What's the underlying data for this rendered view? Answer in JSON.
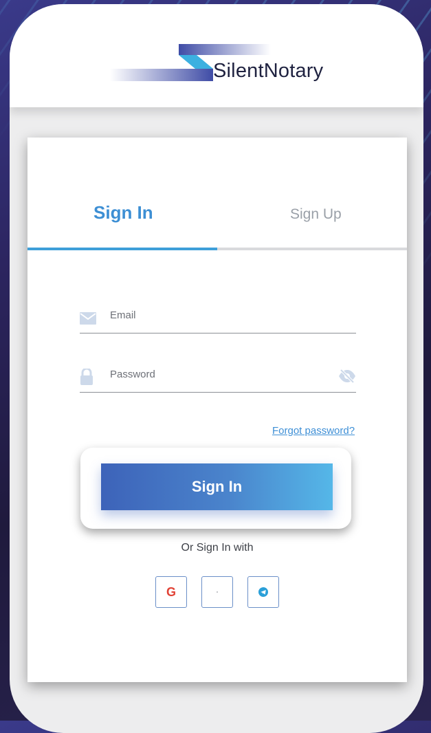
{
  "header": {
    "brand_name": "SilentNotary"
  },
  "tabs": {
    "sign_in": "Sign In",
    "sign_up": "Sign Up",
    "active": "Sign In"
  },
  "form": {
    "email_label": "Email",
    "password_label": "Password",
    "forgot_link": "Forgot password?",
    "submit_label": "Sign In"
  },
  "social": {
    "caption": "Or Sign In with",
    "google_letter": "G",
    "providers": [
      "google-icon",
      "blank-icon",
      "telegram-icon"
    ]
  },
  "colors": {
    "accent": "#3e9fd9",
    "button_gradient_start": "#3d63b9",
    "button_gradient_end": "#55b7e8",
    "text_muted": "#9aa0a8"
  }
}
